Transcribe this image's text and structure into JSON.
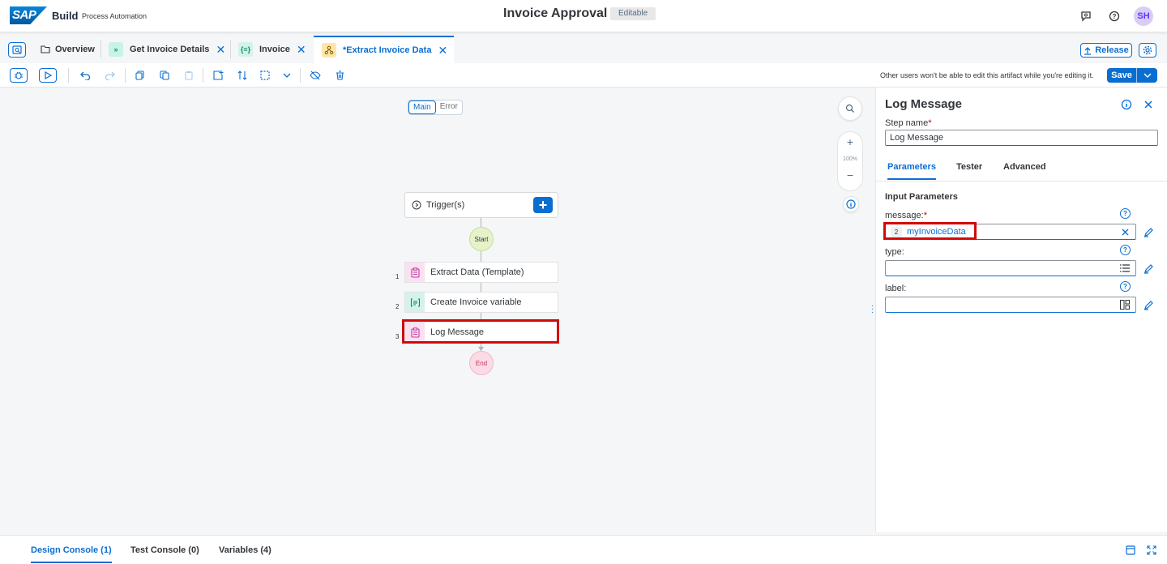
{
  "shell": {
    "logo": "SAP",
    "product": "Build",
    "product_sub": "Process Automation",
    "title": "Invoice Approval",
    "status": "Editable",
    "avatar": "SH"
  },
  "tabs": [
    {
      "label": "Overview",
      "icon": "folder-icon"
    },
    {
      "label": "Get Invoice Details",
      "icon": "decision-icon"
    },
    {
      "label": "Invoice",
      "icon": "data-type-icon"
    },
    {
      "label": "*Extract Invoice Data",
      "icon": "automation-icon",
      "active": true
    }
  ],
  "header_actions": {
    "release_label": "Release"
  },
  "toolbar": {
    "edit_note": "Other users won't be able to edit this artifact while you're editing it.",
    "save_label": "Save"
  },
  "canvas": {
    "segments": [
      "Main",
      "Error"
    ],
    "zoom_level": "100%",
    "trigger_label": "Trigger(s)",
    "start_label": "Start",
    "end_label": "End",
    "steps": [
      {
        "num": "1",
        "label": "Extract Data (Template)",
        "icon": "clipboard-icon"
      },
      {
        "num": "2",
        "label": "Create Invoice variable",
        "icon": "variable-icon"
      },
      {
        "num": "3",
        "label": "Log Message",
        "icon": "clipboard-icon",
        "selected": true
      }
    ]
  },
  "panel": {
    "title": "Log Message",
    "step_name_label": "Step name",
    "step_name_value": "Log Message",
    "tabs": [
      "Parameters",
      "Tester",
      "Advanced"
    ],
    "section_title": "Input Parameters",
    "params": [
      {
        "label": "message:",
        "required": true,
        "token_num": "2",
        "token_value": "myInvoiceData"
      },
      {
        "label": "type:",
        "required": false
      },
      {
        "label": "label:",
        "required": false
      }
    ]
  },
  "bottom_tabs": [
    "Design Console (1)",
    "Test Console (0)",
    "Variables (4)"
  ],
  "colors": {
    "accent": "#0a6ed1",
    "highlight": "#d20a0a",
    "start_node": "#e6f2c8",
    "end_node": "#fadbe6"
  }
}
